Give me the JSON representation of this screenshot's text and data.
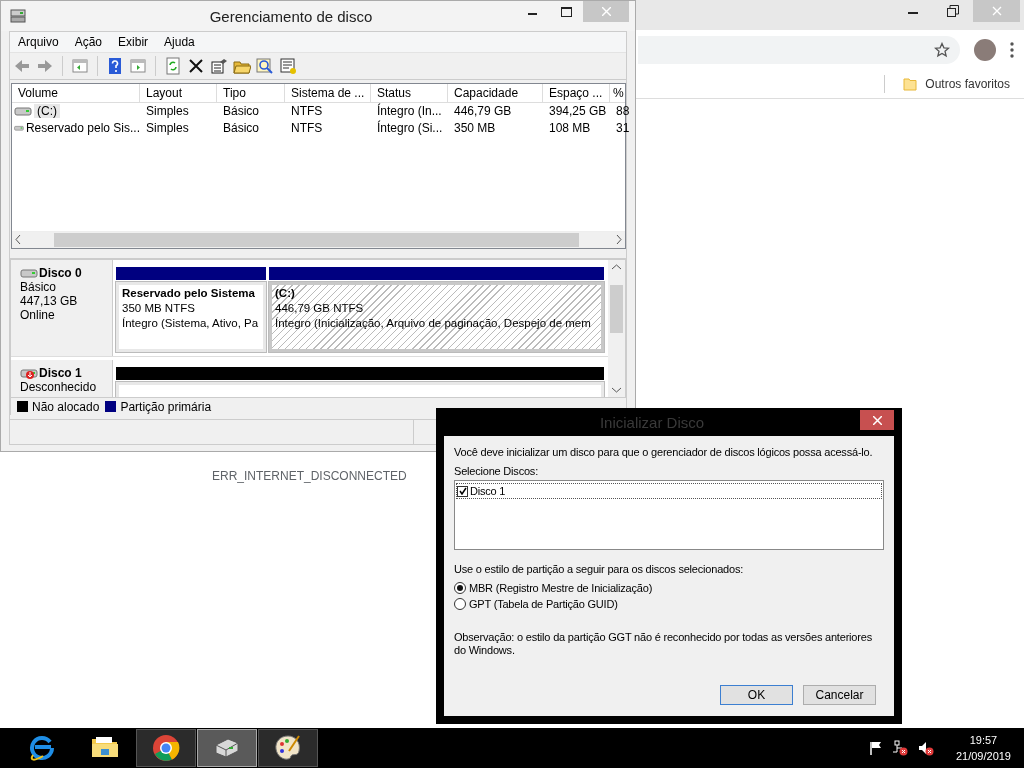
{
  "browser": {
    "bookmarks": [
      {
        "label": "Outros favoritos"
      }
    ],
    "error_text": "ERR_INTERNET_DISCONNECTED"
  },
  "disk_management": {
    "title": "Gerenciamento de disco",
    "menu": [
      "Arquivo",
      "Ação",
      "Exibir",
      "Ajuda"
    ],
    "volume_table": {
      "columns": [
        "Volume",
        "Layout",
        "Tipo",
        "Sistema de ...",
        "Status",
        "Capacidade",
        "Espaço ...",
        "%"
      ],
      "rows": [
        {
          "selected": true,
          "cells": [
            "(C:)",
            "Simples",
            "Básico",
            "NTFS",
            "Íntegro (In...",
            "446,79 GB",
            "394,25 GB",
            "88"
          ]
        },
        {
          "selected": false,
          "cells": [
            "Reservado pelo Sis...",
            "Simples",
            "Básico",
            "NTFS",
            "Íntegro (Si...",
            "350 MB",
            "108 MB",
            "31"
          ]
        }
      ]
    },
    "disks": [
      {
        "name": "Disco 0",
        "initialized": true,
        "type": "Básico",
        "size": "447,13 GB",
        "status": "Online",
        "partitions": [
          {
            "kind": "primary",
            "selected": false,
            "name": "Reservado pelo Sistema",
            "size_fs": "350 MB NTFS",
            "status": "Íntegro (Sistema, Ativo, Pa"
          },
          {
            "kind": "primary",
            "selected": true,
            "name": "(C:)",
            "size_fs": "446,79 GB NTFS",
            "status": "Íntegro (Inicialização, Arquivo de paginação, Despejo de mem"
          }
        ]
      },
      {
        "name": "Disco 1",
        "initialized": false,
        "type": "Desconhecido",
        "partitions": [
          {
            "kind": "unallocated",
            "selected": false
          }
        ]
      }
    ],
    "legend": [
      {
        "label": "Não alocado",
        "color": "#000000"
      },
      {
        "label": "Partição primária",
        "color": "#000080"
      }
    ]
  },
  "dialog": {
    "title": "Inicializar Disco",
    "message": "Você deve inicializar um disco para que o gerenciador de discos lógicos possa acessá-lo.",
    "select_label": "Selecione Discos:",
    "disks": [
      {
        "label": "Disco 1",
        "checked": true
      }
    ],
    "style_label": "Use o estilo de partição a seguir para os discos selecionados:",
    "styles": [
      {
        "label": "MBR (Registro Mestre de Inicialização)",
        "selected": true
      },
      {
        "label": "GPT (Tabela de Partição GUID)",
        "selected": false
      }
    ],
    "note": "Observação: o estilo da partição GGT não é reconhecido por todas as versões anteriores do Windows.",
    "buttons": [
      "OK",
      "Cancelar"
    ]
  },
  "taskbar": {
    "apps": [
      {
        "kind": "ie",
        "running": false,
        "selected": false
      },
      {
        "kind": "explorer",
        "running": false,
        "selected": false
      },
      {
        "kind": "chrome",
        "running": true,
        "selected": false
      },
      {
        "kind": "disk",
        "running": true,
        "selected": true
      },
      {
        "kind": "paint",
        "running": true,
        "selected": false
      }
    ],
    "clock": {
      "time": "19:57",
      "date": "21/09/2019"
    }
  }
}
